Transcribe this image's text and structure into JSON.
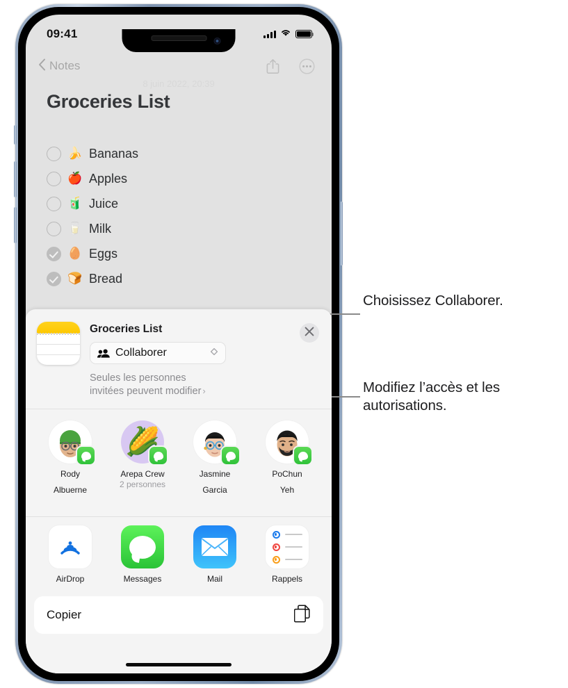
{
  "status_bar": {
    "time": "09:41",
    "signal_icon": "cellular-bars-icon",
    "wifi_icon": "wifi-icon",
    "battery_icon": "battery-full-icon"
  },
  "note_screen": {
    "back_label": "Notes",
    "share_icon": "share-icon",
    "more_icon": "more-ellipsis-icon",
    "date": "8 juin 2022, 20:39",
    "title": "Groceries List",
    "checklist": [
      {
        "emoji": "🍌",
        "label": "Bananas",
        "checked": false
      },
      {
        "emoji": "🍎",
        "label": "Apples",
        "checked": false
      },
      {
        "emoji": "🧃",
        "label": "Juice",
        "checked": false
      },
      {
        "emoji": "🥛",
        "label": "Milk",
        "checked": false
      },
      {
        "emoji": "🥚",
        "label": "Eggs",
        "checked": true
      },
      {
        "emoji": "🍞",
        "label": "Bread",
        "checked": true
      }
    ]
  },
  "share_sheet": {
    "app_icon": "notes-app-icon",
    "title": "Groceries List",
    "dropdown": {
      "icon": "people-icon",
      "value": "Collaborer",
      "chevron_icon": "up-down-chevron-icon"
    },
    "permission_text": "Seules les personnes invitées peuvent modifier",
    "permission_chevron": "›",
    "close_icon": "close-x-icon",
    "contacts": [
      {
        "name_line1": "Rody",
        "name_line2": "Albuerne",
        "subtitle": "",
        "avatar": "memoji-green-beanie",
        "emoji": "🧑‍🦱",
        "badge": "messages-badge",
        "bg": "white"
      },
      {
        "name_line1": "Arepa Crew",
        "name_line2": "",
        "subtitle": "2 personnes",
        "avatar": "group-corn-emoji",
        "emoji": "🌽",
        "badge": "messages-badge",
        "bg": "purple"
      },
      {
        "name_line1": "Jasmine",
        "name_line2": "Garcia",
        "subtitle": "",
        "avatar": "memoji-blue-glasses",
        "emoji": "👩",
        "badge": "messages-badge",
        "bg": "white"
      },
      {
        "name_line1": "PoChun",
        "name_line2": "Yeh",
        "subtitle": "",
        "avatar": "memoji-beard",
        "emoji": "🧔",
        "badge": "messages-badge",
        "bg": "white"
      }
    ],
    "apps": [
      {
        "name": "AirDrop",
        "icon": "airdrop-icon"
      },
      {
        "name": "Messages",
        "icon": "messages-icon"
      },
      {
        "name": "Mail",
        "icon": "mail-icon"
      },
      {
        "name": "Rappels",
        "icon": "reminders-icon"
      }
    ],
    "actions": [
      {
        "label": "Copier",
        "icon": "copy-documents-icon"
      }
    ]
  },
  "callouts": [
    {
      "text": "Choisissez Collaborer."
    },
    {
      "text": "Modifiez l’accès et les autorisations."
    }
  ],
  "colors": {
    "notes_yellow": "#ffd21e",
    "messages_green": "#30c23a",
    "mail_blue": "#1f86f5",
    "airdrop_blue": "#1271e0",
    "sheet_bg": "#f4f4f4",
    "screen_bg": "#e2e2e2"
  }
}
